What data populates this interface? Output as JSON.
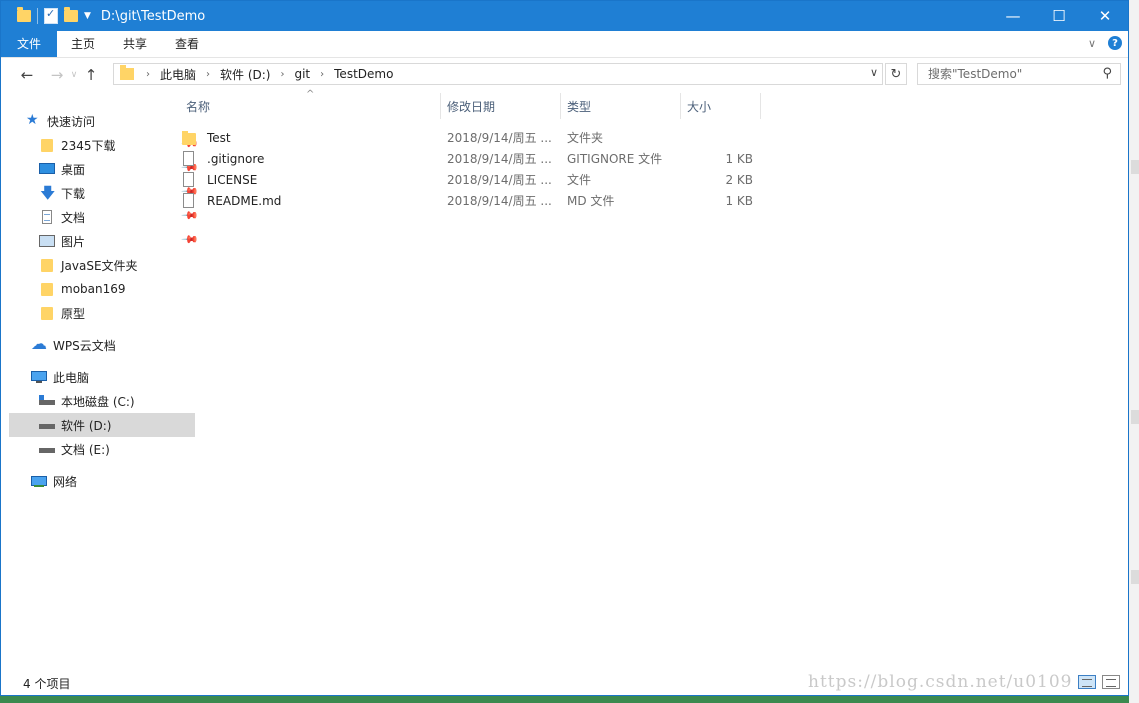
{
  "window": {
    "title": "D:\\git\\TestDemo",
    "controls": {
      "minimize": "—",
      "maximize": "☐",
      "close": "✕"
    }
  },
  "ribbon": {
    "tabs": [
      "文件",
      "主页",
      "共享",
      "查看"
    ],
    "help": "?"
  },
  "nav": {
    "back": "←",
    "forward": "→",
    "up": "↑",
    "breadcrumb": [
      "此电脑",
      "软件 (D:)",
      "git",
      "TestDemo"
    ],
    "search_placeholder": "搜索\"TestDemo\""
  },
  "sidebar": {
    "quick_access": "快速访问",
    "quick_items": [
      {
        "label": "2345下载",
        "icon": "folder-icon",
        "pinned": true
      },
      {
        "label": "桌面",
        "icon": "desktop-icon",
        "pinned": true
      },
      {
        "label": "下载",
        "icon": "download-icon",
        "pinned": true
      },
      {
        "label": "文档",
        "icon": "document-icon",
        "pinned": true
      },
      {
        "label": "图片",
        "icon": "pictures-icon",
        "pinned": true
      },
      {
        "label": "JavaSE文件夹",
        "icon": "folder-icon",
        "pinned": false
      },
      {
        "label": "moban169",
        "icon": "folder-icon",
        "pinned": false
      },
      {
        "label": "原型",
        "icon": "folder-icon",
        "pinned": false
      }
    ],
    "wps": "WPS云文档",
    "this_pc": "此电脑",
    "drives": [
      {
        "label": "本地磁盘 (C:)",
        "selected": false
      },
      {
        "label": "软件 (D:)",
        "selected": true
      },
      {
        "label": "文档 (E:)",
        "selected": false
      }
    ],
    "network": "网络"
  },
  "columns": {
    "name": "名称",
    "date": "修改日期",
    "type": "类型",
    "size": "大小"
  },
  "files": [
    {
      "name": "Test",
      "date": "2018/9/14/周五 ...",
      "type": "文件夹",
      "size": "",
      "kind": "folder"
    },
    {
      "name": ".gitignore",
      "date": "2018/9/14/周五 ...",
      "type": "GITIGNORE 文件",
      "size": "1 KB",
      "kind": "file"
    },
    {
      "name": "LICENSE",
      "date": "2018/9/14/周五 ...",
      "type": "文件",
      "size": "2 KB",
      "kind": "file"
    },
    {
      "name": "README.md",
      "date": "2018/9/14/周五 ...",
      "type": "MD 文件",
      "size": "1 KB",
      "kind": "file"
    }
  ],
  "status": {
    "count": "4 个项目"
  },
  "watermark": "https://blog.csdn.net/u0109",
  "colors": {
    "accent": "#1f7fd4",
    "folder": "#ffd466",
    "selected": "#d9d9d9"
  }
}
